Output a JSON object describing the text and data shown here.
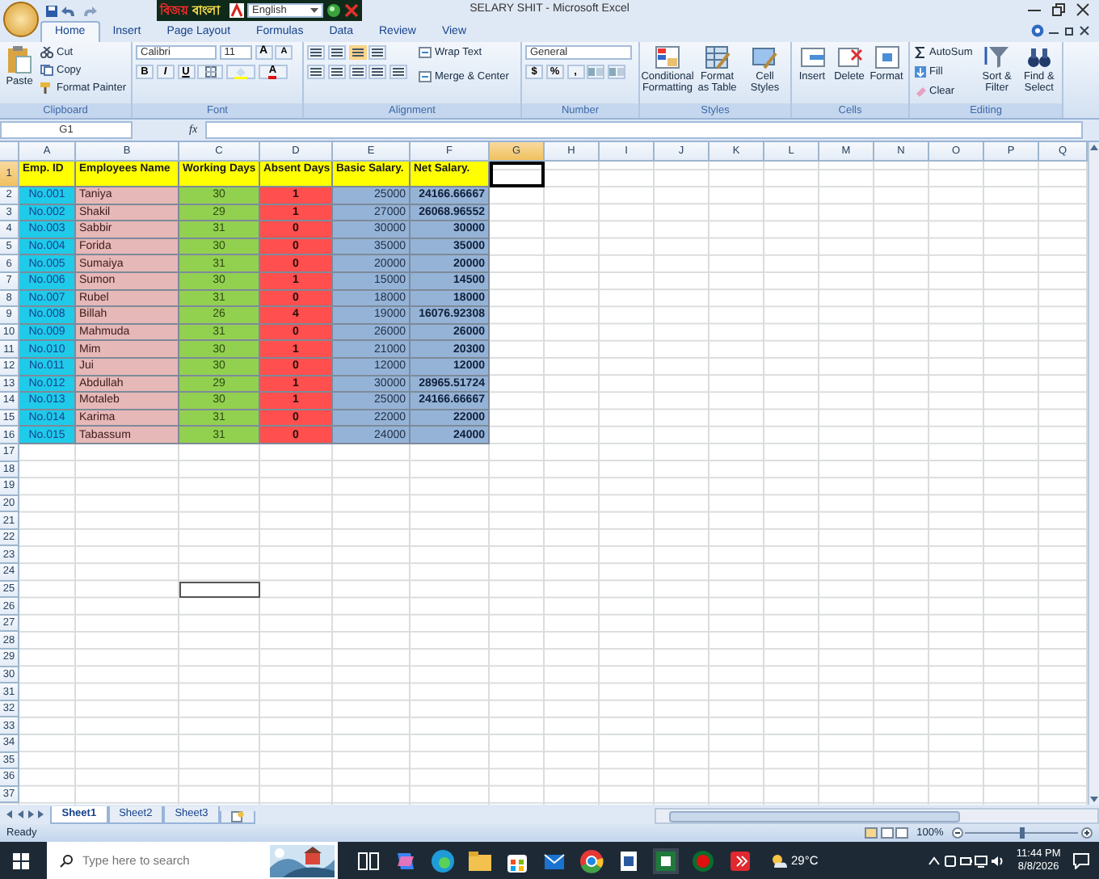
{
  "window": {
    "title": "SELARY SHIT - Microsoft Excel"
  },
  "bangla_toolbar": {
    "app_name_1": "বিজয়",
    "app_name_2": "বাংলা",
    "language": "English"
  },
  "ribbon_tabs": [
    {
      "label": "Home",
      "selected": true
    },
    {
      "label": "Insert",
      "selected": false
    },
    {
      "label": "Page Layout",
      "selected": false
    },
    {
      "label": "Formulas",
      "selected": false
    },
    {
      "label": "Data",
      "selected": false
    },
    {
      "label": "Review",
      "selected": false
    },
    {
      "label": "View",
      "selected": false
    }
  ],
  "clipboard": {
    "label": "Clipboard",
    "paste": "Paste",
    "cut": "Cut",
    "copy": "Copy",
    "format_painter": "Format Painter"
  },
  "font": {
    "label": "Font",
    "name": "Calibri",
    "size": "11",
    "bold": "B",
    "italic": "I",
    "underline": "U",
    "grow": "A",
    "shrink": "A",
    "color_button": "A"
  },
  "alignment": {
    "label": "Alignment",
    "wrap_text": "Wrap Text",
    "merge": "Merge & Center"
  },
  "number": {
    "label": "Number",
    "format": "General",
    "currency": "$",
    "percent": "%",
    "comma": ","
  },
  "styles": {
    "label": "Styles",
    "buttons": [
      "Conditional Formatting",
      "Format as Table",
      "Cell Styles"
    ]
  },
  "cells": {
    "label": "Cells",
    "buttons": [
      "Insert",
      "Delete",
      "Format"
    ]
  },
  "editing": {
    "label": "Editing",
    "autosum": "AutoSum",
    "fill": "Fill",
    "clear": "Clear",
    "sort": "Sort & Filter",
    "find": "Find & Select"
  },
  "formula_bar": {
    "name_box": "G1",
    "fx": "fx"
  },
  "column_headers": [
    {
      "label": "A",
      "selected": false
    },
    {
      "label": "B",
      "selected": false
    },
    {
      "label": "C",
      "selected": false
    },
    {
      "label": "D",
      "selected": false
    },
    {
      "label": "E",
      "selected": false
    },
    {
      "label": "F",
      "selected": false
    },
    {
      "label": "G",
      "selected": true
    },
    {
      "label": "H",
      "selected": false
    },
    {
      "label": "I",
      "selected": false
    },
    {
      "label": "J",
      "selected": false
    },
    {
      "label": "K",
      "selected": false
    },
    {
      "label": "L",
      "selected": false
    },
    {
      "label": "M",
      "selected": false
    },
    {
      "label": "N",
      "selected": false
    },
    {
      "label": "O",
      "selected": false
    },
    {
      "label": "P",
      "selected": false
    },
    {
      "label": "Q",
      "selected": false
    }
  ],
  "row_headers": [
    {
      "label": "1",
      "selected": true
    },
    {
      "label": "2",
      "selected": false
    },
    {
      "label": "3",
      "selected": false
    },
    {
      "label": "4",
      "selected": false
    },
    {
      "label": "5",
      "selected": false
    },
    {
      "label": "6",
      "selected": false
    },
    {
      "label": "7",
      "selected": false
    },
    {
      "label": "8",
      "selected": false
    },
    {
      "label": "9",
      "selected": false
    },
    {
      "label": "10",
      "selected": false
    },
    {
      "label": "11",
      "selected": false
    },
    {
      "label": "12",
      "selected": false
    },
    {
      "label": "13",
      "selected": false
    },
    {
      "label": "14",
      "selected": false
    },
    {
      "label": "15",
      "selected": false
    },
    {
      "label": "16",
      "selected": false
    },
    {
      "label": "17",
      "selected": false
    },
    {
      "label": "18",
      "selected": false
    },
    {
      "label": "19",
      "selected": false
    },
    {
      "label": "20",
      "selected": false
    },
    {
      "label": "21",
      "selected": false
    },
    {
      "label": "22",
      "selected": false
    },
    {
      "label": "23",
      "selected": false
    },
    {
      "label": "24",
      "selected": false
    },
    {
      "label": "25",
      "selected": false
    },
    {
      "label": "26",
      "selected": false
    },
    {
      "label": "27",
      "selected": false
    },
    {
      "label": "28",
      "selected": false
    },
    {
      "label": "29",
      "selected": false
    },
    {
      "label": "30",
      "selected": false
    },
    {
      "label": "31",
      "selected": false
    },
    {
      "label": "32",
      "selected": false
    },
    {
      "label": "33",
      "selected": false
    },
    {
      "label": "34",
      "selected": false
    },
    {
      "label": "35",
      "selected": false
    },
    {
      "label": "36",
      "selected": false
    },
    {
      "label": "37",
      "selected": false
    }
  ],
  "table": {
    "columns": [
      {
        "header": "Emp. ID",
        "color": "#1fcbe8"
      },
      {
        "header": "Employees Name",
        "color": "#e6b8b7"
      },
      {
        "header": "Working Days",
        "color": "#92d050"
      },
      {
        "header": "Absent Days",
        "color": "#ff4f4f"
      },
      {
        "header": "Basic Salary.",
        "color": "#95b3d7"
      },
      {
        "header": "Net Salary.",
        "color": "#95b3d7"
      }
    ],
    "rows": [
      [
        "No.001",
        "Taniya",
        "30",
        "1",
        "25000",
        "24166.66667"
      ],
      [
        "No.002",
        "Shakil",
        "29",
        "1",
        "27000",
        "26068.96552"
      ],
      [
        "No.003",
        "Sabbir",
        "31",
        "0",
        "30000",
        "30000"
      ],
      [
        "No.004",
        "Forida",
        "30",
        "0",
        "35000",
        "35000"
      ],
      [
        "No.005",
        "Sumaiya",
        "31",
        "0",
        "20000",
        "20000"
      ],
      [
        "No.006",
        "Sumon",
        "30",
        "1",
        "15000",
        "14500"
      ],
      [
        "No.007",
        "Rubel",
        "31",
        "0",
        "18000",
        "18000"
      ],
      [
        "No.008",
        "Billah",
        "26",
        "4",
        "19000",
        "16076.92308"
      ],
      [
        "No.009",
        "Mahmuda",
        "31",
        "0",
        "26000",
        "26000"
      ],
      [
        "No.010",
        "Mim",
        "30",
        "1",
        "21000",
        "20300"
      ],
      [
        "No.011",
        "Jui",
        "30",
        "0",
        "12000",
        "12000"
      ],
      [
        "No.012",
        "Abdullah",
        "29",
        "1",
        "30000",
        "28965.51724"
      ],
      [
        "No.013",
        "Motaleb",
        "30",
        "1",
        "25000",
        "24166.66667"
      ],
      [
        "No.014",
        "Karima",
        "31",
        "0",
        "22000",
        "22000"
      ],
      [
        "No.015",
        "Tabassum",
        "31",
        "0",
        "24000",
        "24000"
      ]
    ]
  },
  "sheet_tabs": [
    {
      "label": "Sheet1",
      "selected": true
    },
    {
      "label": "Sheet2",
      "selected": false
    },
    {
      "label": "Sheet3",
      "selected": false
    }
  ],
  "status_bar": {
    "text": "Ready",
    "zoom": "100%",
    "level": 0.5
  },
  "taskbar": {
    "search_placeholder": "Type here to search",
    "temperature": "29°C",
    "time": "11:44 PM",
    "date": "8/8/2026"
  }
}
